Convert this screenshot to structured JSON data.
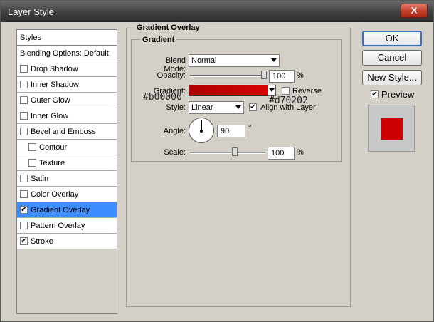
{
  "window": {
    "title": "Layer Style",
    "close_label": "X"
  },
  "sidebar": {
    "styles_label": "Styles",
    "blending_label": "Blending Options: Default",
    "items": [
      {
        "label": "Drop Shadow",
        "checked": false,
        "sub": false
      },
      {
        "label": "Inner Shadow",
        "checked": false,
        "sub": false
      },
      {
        "label": "Outer Glow",
        "checked": false,
        "sub": false
      },
      {
        "label": "Inner Glow",
        "checked": false,
        "sub": false
      },
      {
        "label": "Bevel and Emboss",
        "checked": false,
        "sub": false
      },
      {
        "label": "Contour",
        "checked": false,
        "sub": true
      },
      {
        "label": "Texture",
        "checked": false,
        "sub": true
      },
      {
        "label": "Satin",
        "checked": false,
        "sub": false
      },
      {
        "label": "Color Overlay",
        "checked": false,
        "sub": false
      },
      {
        "label": "Gradient Overlay",
        "checked": true,
        "sub": false,
        "selected": true
      },
      {
        "label": "Pattern Overlay",
        "checked": false,
        "sub": false
      },
      {
        "label": "Stroke",
        "checked": true,
        "sub": false
      }
    ]
  },
  "panel": {
    "group_title": "Gradient Overlay",
    "inner_title": "Gradient",
    "blend_mode_label": "Blend Mode:",
    "blend_mode_value": "Normal",
    "opacity_label": "Opacity:",
    "opacity_value": "100",
    "opacity_fraction": 1.0,
    "percent": "%",
    "gradient_label": "Gradient:",
    "gradient_start_color": "#b00000",
    "gradient_end_color": "#d70202",
    "gradient_start_text": "#b00000",
    "gradient_end_text": "#d70202",
    "reverse_label": "Reverse",
    "reverse_checked": false,
    "style_label": "Style:",
    "style_value": "Linear",
    "align_label": "Align with Layer",
    "align_checked": true,
    "angle_label": "Angle:",
    "angle_value": "90",
    "degree": "°",
    "scale_label": "Scale:",
    "scale_value": "100",
    "scale_fraction": 0.5
  },
  "buttons": {
    "ok": "OK",
    "cancel": "Cancel",
    "new_style": "New Style...",
    "preview_label": "Preview",
    "preview_checked": true
  },
  "preview": {
    "swatch_color": "#cc0000"
  }
}
